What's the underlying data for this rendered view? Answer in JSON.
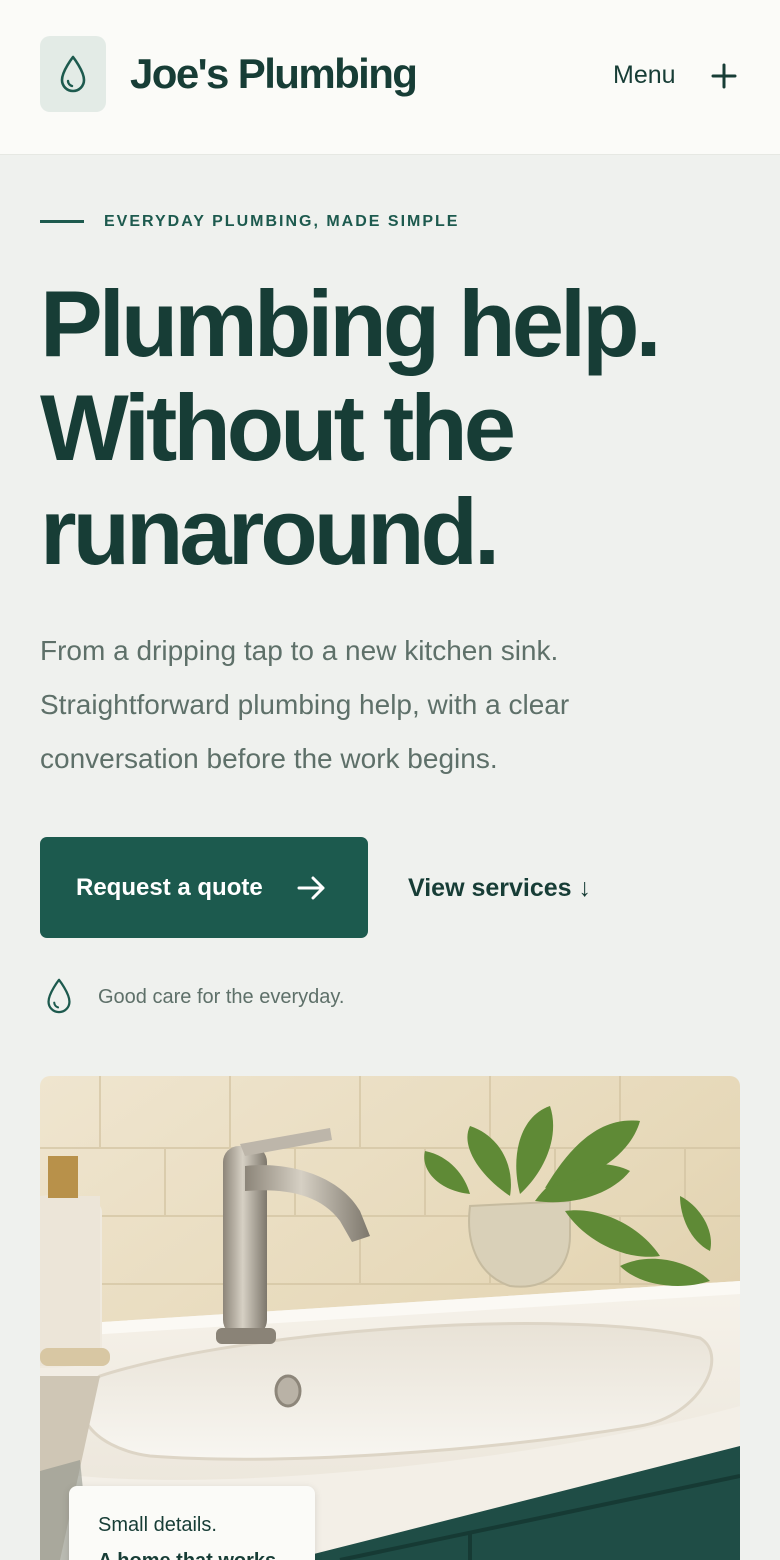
{
  "brand": {
    "name": "Joe's Plumbing",
    "logo_icon": "water-drop-icon"
  },
  "nav": {
    "menu_label": "Menu",
    "menu_icon": "plus-icon"
  },
  "hero": {
    "eyebrow": "EVERYDAY PLUMBING, MADE SIMPLE",
    "headline_lines": [
      "Plumbing help.",
      "Without the",
      "runaround."
    ],
    "lede_lines": [
      "From a dripping tap to a new kitchen sink.",
      "Straightforward plumbing help, with a clear",
      "conversation before the work begins."
    ],
    "primary_cta": "Request a quote",
    "primary_cta_icon": "arrow-right-icon",
    "secondary_cta": "View services ↓",
    "tagline": "Good care for the everyday.",
    "tagline_icon": "water-drop-icon"
  },
  "image_card": {
    "line1": "Small details.",
    "line2": "A home that works."
  },
  "colors": {
    "brand_green": "#1c5a4e",
    "ink": "#173d36",
    "muted": "#5e7069",
    "page_bg": "#eff1ee",
    "header_bg": "#fbfbf8"
  }
}
